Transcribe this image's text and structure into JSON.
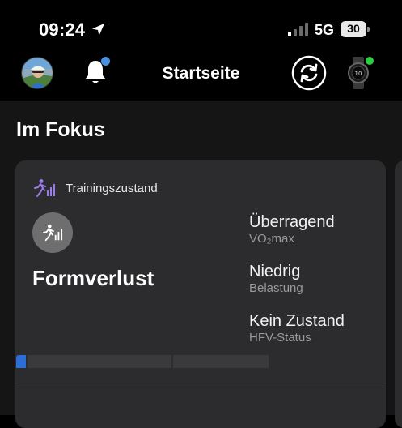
{
  "status_bar": {
    "time": "09:24",
    "network": "5G",
    "battery": "30",
    "icons": [
      "location-arrow-icon",
      "signal-icon",
      "battery-icon"
    ]
  },
  "nav": {
    "title": "Startseite",
    "icons": [
      "avatar",
      "bell-icon",
      "sync-icon",
      "watch-icon"
    ],
    "colors": {
      "notification_dot": "#4a90e2",
      "device_dot": "#2ecc40"
    }
  },
  "main": {
    "section_title": "Im Fokus",
    "card": {
      "header": "Trainingszustand",
      "header_icon": "running-figure-icon",
      "state": "Formverlust",
      "state_icon": "running-figure-icon",
      "accent": "#9b7bea",
      "metrics": [
        {
          "value": "Überragend",
          "label": "VO₂max"
        },
        {
          "value": "Niedrig",
          "label": "Belastung"
        },
        {
          "value": "Kein Zustand",
          "label": "HFV-Status"
        }
      ]
    }
  }
}
